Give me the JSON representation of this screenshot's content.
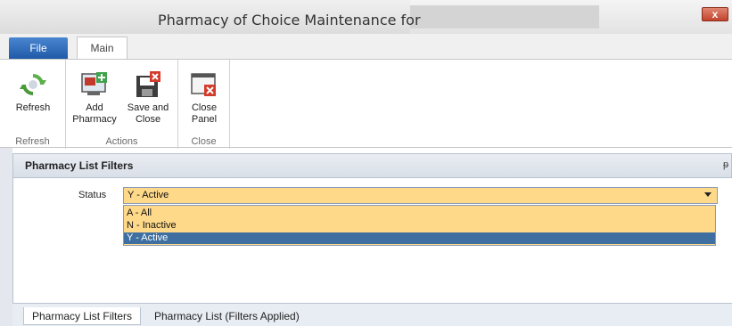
{
  "window": {
    "title": "Pharmacy of Choice Maintenance for",
    "close_glyph": "x"
  },
  "tabs": {
    "file": "File",
    "main": "Main"
  },
  "ribbon": {
    "groups": [
      {
        "label": "Refresh",
        "buttons": [
          {
            "label": "Refresh",
            "icon": "refresh-icon"
          }
        ]
      },
      {
        "label": "Actions",
        "buttons": [
          {
            "label": "Add\nPharmacy",
            "icon": "add-pharmacy-icon"
          },
          {
            "label": "Save and\nClose",
            "icon": "save-close-icon"
          }
        ]
      },
      {
        "label": "Close",
        "buttons": [
          {
            "label": "Close\nPanel",
            "icon": "close-panel-icon"
          }
        ]
      }
    ]
  },
  "panel": {
    "title": "Pharmacy List Filters",
    "pin_glyph": "ᵽ",
    "status": {
      "label": "Status",
      "value": "Y - Active",
      "options": [
        "A - All",
        "N - Inactive",
        "Y - Active"
      ],
      "selected_index": 2
    }
  },
  "bottom_tabs": [
    "Pharmacy List Filters",
    "Pharmacy List (Filters Applied)"
  ],
  "colors": {
    "select_bg": "#ffd98a",
    "selected_item": "#3e6fa0",
    "file_tab": "#1f5aa8"
  }
}
